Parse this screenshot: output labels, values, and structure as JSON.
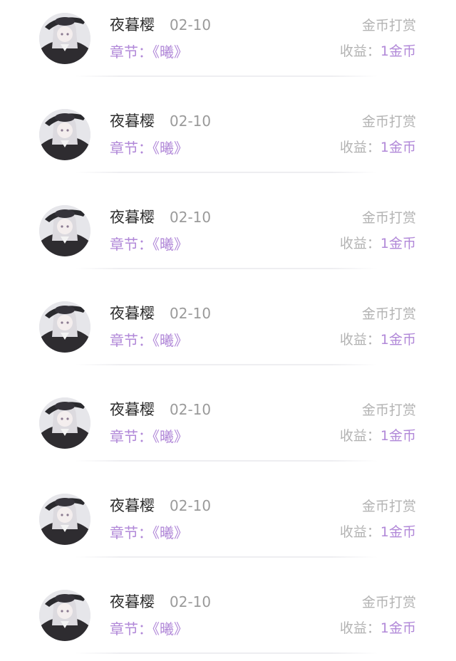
{
  "entries": [
    {
      "name": "夜暮樱",
      "date": "02-10",
      "type": "金币打赏",
      "chapter": "章节：《曦》",
      "income_label": "收益：",
      "income_value": "1金币"
    },
    {
      "name": "夜暮樱",
      "date": "02-10",
      "type": "金币打赏",
      "chapter": "章节：《曦》",
      "income_label": "收益：",
      "income_value": "1金币"
    },
    {
      "name": "夜暮樱",
      "date": "02-10",
      "type": "金币打赏",
      "chapter": "章节：《曦》",
      "income_label": "收益：",
      "income_value": "1金币"
    },
    {
      "name": "夜暮樱",
      "date": "02-10",
      "type": "金币打赏",
      "chapter": "章节：《曦》",
      "income_label": "收益：",
      "income_value": "1金币"
    },
    {
      "name": "夜暮樱",
      "date": "02-10",
      "type": "金币打赏",
      "chapter": "章节：《曦》",
      "income_label": "收益：",
      "income_value": "1金币"
    },
    {
      "name": "夜暮樱",
      "date": "02-10",
      "type": "金币打赏",
      "chapter": "章节：《曦》",
      "income_label": "收益：",
      "income_value": "1金币"
    },
    {
      "name": "夜暮樱",
      "date": "02-10",
      "type": "金币打赏",
      "chapter": "章节：《曦》",
      "income_label": "收益：",
      "income_value": "1金币"
    }
  ],
  "colors": {
    "accent": "#b188d8",
    "name_text": "#2b2b2b",
    "muted_text": "#9a9a9a",
    "light_text": "#b3b3b3",
    "divider": "#eeeef1"
  },
  "icons": {
    "avatar": "user-avatar-icon"
  }
}
